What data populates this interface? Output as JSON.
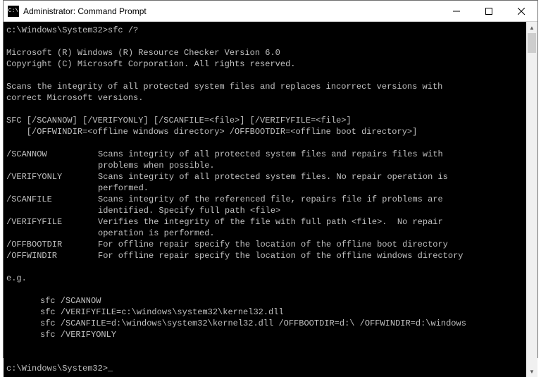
{
  "window": {
    "title": "Administrator: Command Prompt",
    "icon_label": "C:\\"
  },
  "prompt1": {
    "path": "c:\\Windows\\System32>",
    "cmd": "sfc /?"
  },
  "header1": "Microsoft (R) Windows (R) Resource Checker Version 6.0",
  "header2": "Copyright (C) Microsoft Corporation. All rights reserved.",
  "desc1": "Scans the integrity of all protected system files and replaces incorrect versions with",
  "desc2": "correct Microsoft versions.",
  "usage1": "SFC [/SCANNOW] [/VERIFYONLY] [/SCANFILE=<file>] [/VERIFYFILE=<file>]",
  "usage2": "    [/OFFWINDIR=<offline windows directory> /OFFBOOTDIR=<offline boot directory>]",
  "options": [
    {
      "key": "/SCANNOW",
      "desc": "Scans integrity of all protected system files and repairs files with\nproblems when possible."
    },
    {
      "key": "/VERIFYONLY",
      "desc": "Scans integrity of all protected system files. No repair operation is\nperformed."
    },
    {
      "key": "/SCANFILE",
      "desc": "Scans integrity of the referenced file, repairs file if problems are\nidentified. Specify full path <file>"
    },
    {
      "key": "/VERIFYFILE",
      "desc": "Verifies the integrity of the file with full path <file>.  No repair\noperation is performed."
    },
    {
      "key": "/OFFBOOTDIR",
      "desc": "For offline repair specify the location of the offline boot directory"
    },
    {
      "key": "/OFFWINDIR",
      "desc": "For offline repair specify the location of the offline windows directory"
    }
  ],
  "eg_label": "e.g.",
  "examples": [
    "sfc /SCANNOW",
    "sfc /VERIFYFILE=c:\\windows\\system32\\kernel32.dll",
    "sfc /SCANFILE=d:\\windows\\system32\\kernel32.dll /OFFBOOTDIR=d:\\ /OFFWINDIR=d:\\windows",
    "sfc /VERIFYONLY"
  ],
  "prompt2": {
    "path": "c:\\Windows\\System32>",
    "cursor": "_"
  }
}
